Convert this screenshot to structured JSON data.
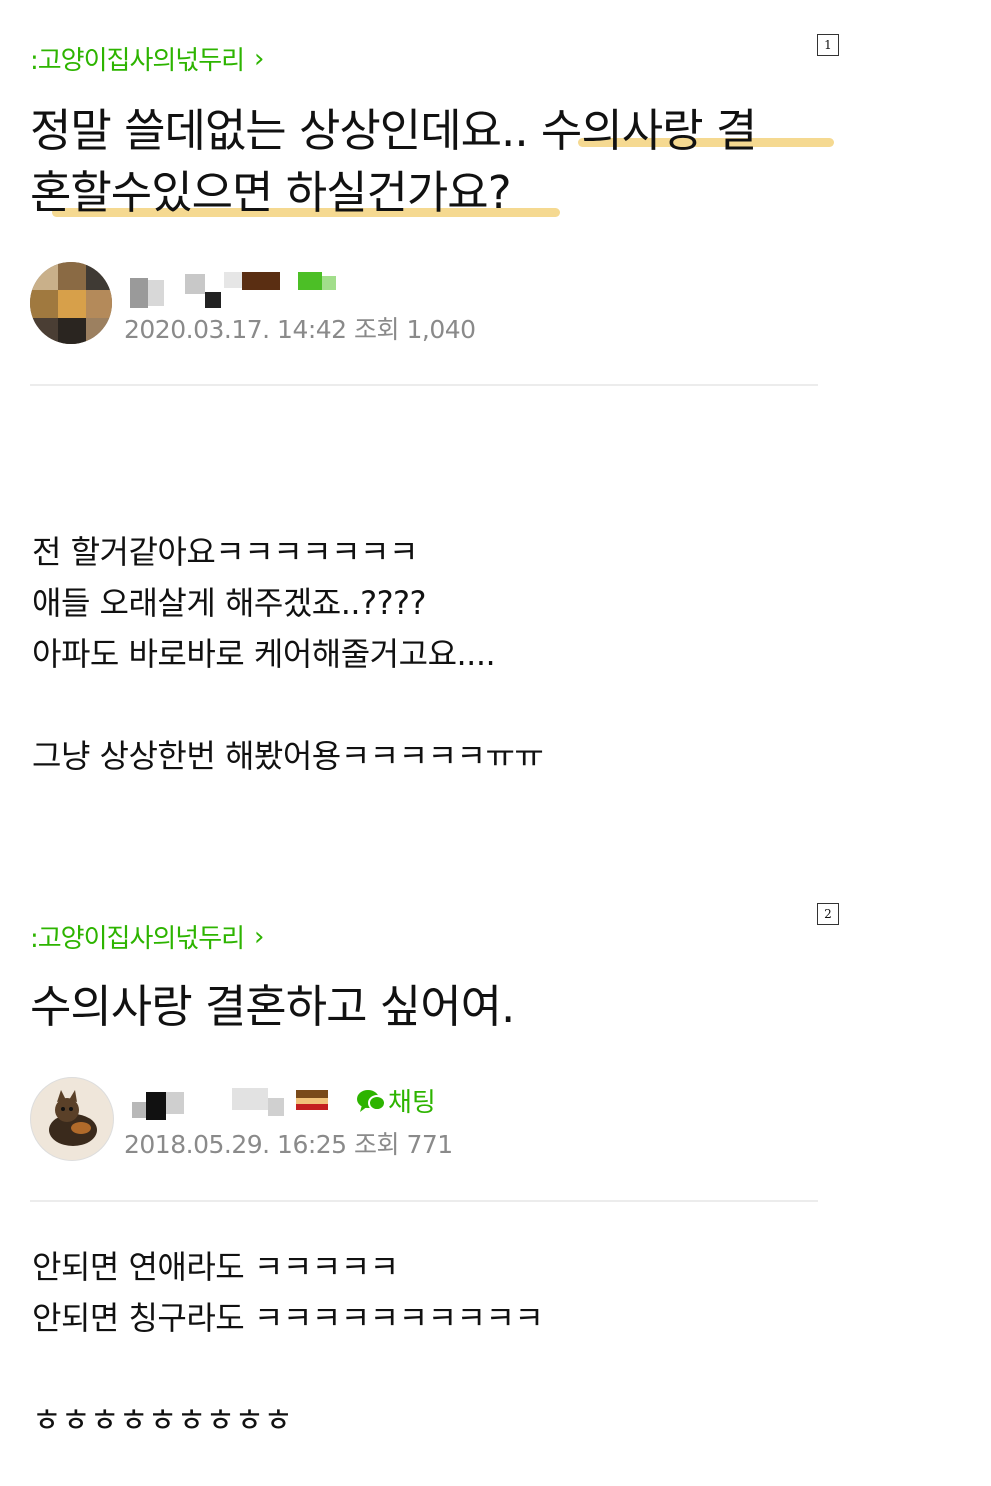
{
  "post1": {
    "page_number": "1",
    "board": ":고양이집사의넋두리",
    "board_chevron": "›",
    "title_line1": "정말 쓸데없는 상상인데요.. 수의사랑 결",
    "title_line2": "혼할수있으면 하실건가요?",
    "meta": "2020.03.17. 14:42 조회 1,040",
    "body_lines": [
      "전 할거같아요ㅋㅋㅋㅋㅋㅋㅋ",
      "애들 오래살게 해주겠죠..????",
      "아파도 바로바로 케어해줄거고요....",
      "",
      "그냥 상상한번 해봤어용ㅋㅋㅋㅋㅋㅠㅠ"
    ]
  },
  "post2": {
    "page_number": "2",
    "board": ":고양이집사의넋두리",
    "board_chevron": "›",
    "title": "수의사랑 결혼하고 싶어여.",
    "chat_label": "채팅",
    "meta": "2018.05.29. 16:25 조회 771",
    "body_lines": [
      "안되면 연애라도 ㅋㅋㅋㅋㅋ",
      "안되면 칭구라도 ㅋㅋㅋㅋㅋㅋㅋㅋㅋㅋ",
      "",
      "ㅎㅎㅎㅎㅎㅎㅎㅎㅎ"
    ]
  },
  "colors": {
    "accent_green": "#2db400",
    "highlight": "#f2cf76",
    "meta_gray": "#8a8a8a",
    "divider": "#ececec"
  }
}
